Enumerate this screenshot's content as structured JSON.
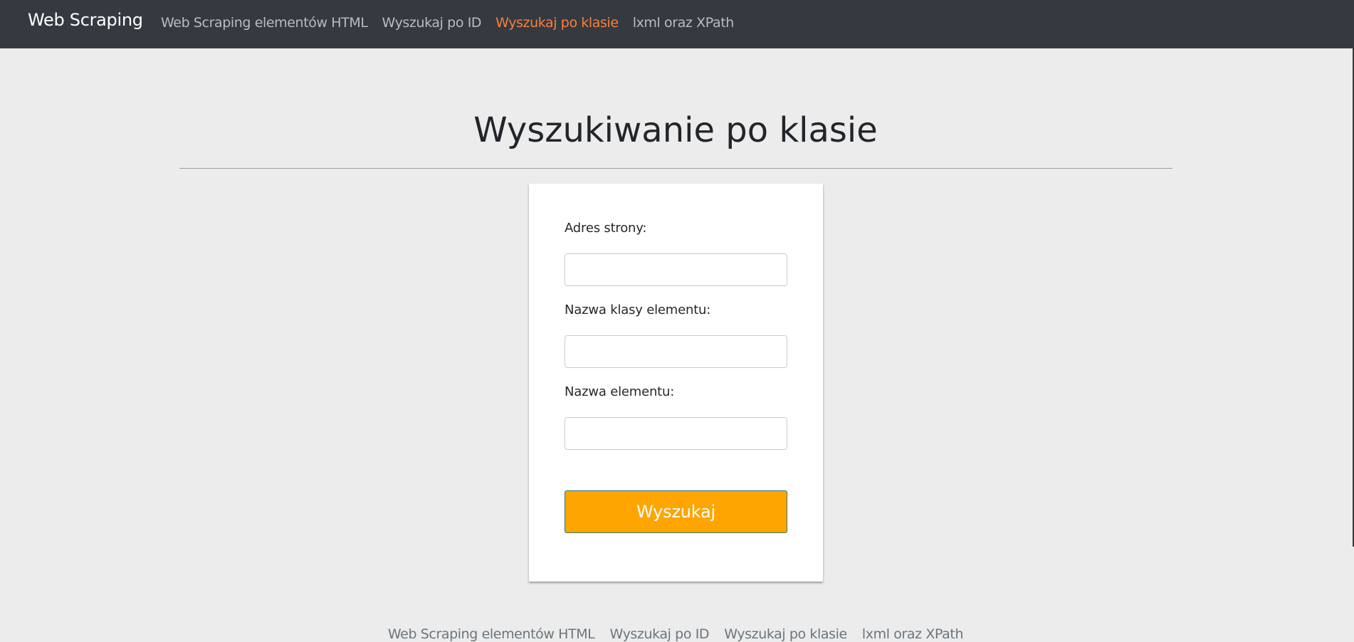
{
  "navbar": {
    "brand": "Web Scraping",
    "links": [
      {
        "label": "Web Scraping elementów HTML",
        "active": false
      },
      {
        "label": "Wyszukaj po ID",
        "active": false
      },
      {
        "label": "Wyszukaj po klasie",
        "active": true
      },
      {
        "label": "lxml oraz XPath",
        "active": false
      }
    ],
    "background_color": "#343a40",
    "active_color": "#fd7e3c"
  },
  "main": {
    "title": "Wyszukiwanie po klasie"
  },
  "form": {
    "fields": [
      {
        "label": "Adres strony:",
        "value": ""
      },
      {
        "label": "Nazwa klasy elementu:",
        "value": ""
      },
      {
        "label": "Nazwa elementu:",
        "value": ""
      }
    ],
    "submit_label": "Wyszukaj",
    "submit_color": "#ffa500"
  },
  "footer": {
    "links": [
      "Web Scraping elementów HTML",
      "Wyszukaj po ID",
      "Wyszukaj po klasie",
      "lxml oraz XPath"
    ]
  }
}
